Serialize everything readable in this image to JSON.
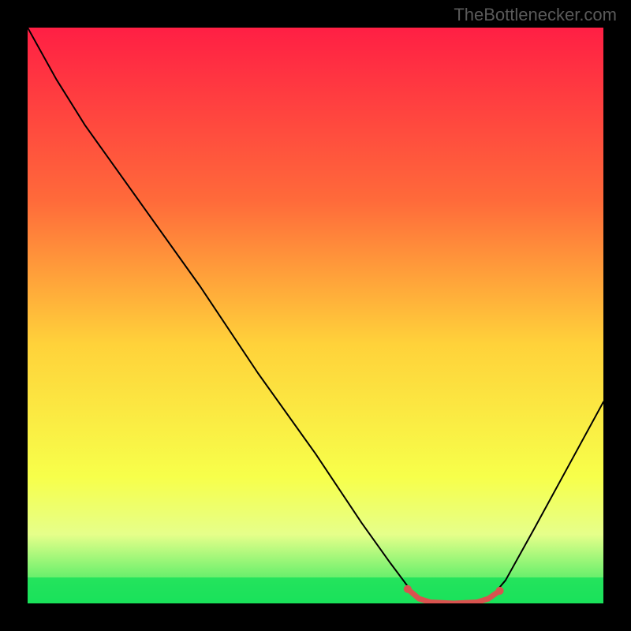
{
  "watermark": "TheBottlenecker.com",
  "chart_data": {
    "type": "line",
    "title": "",
    "xlabel": "",
    "ylabel": "",
    "xlim": [
      0,
      100
    ],
    "ylim": [
      0,
      100
    ],
    "background_gradient": {
      "stops": [
        {
          "offset": 0,
          "color": "#ff1f44"
        },
        {
          "offset": 30,
          "color": "#ff6a3a"
        },
        {
          "offset": 55,
          "color": "#ffd23a"
        },
        {
          "offset": 78,
          "color": "#f7ff4a"
        },
        {
          "offset": 88,
          "color": "#e6ff8a"
        },
        {
          "offset": 100,
          "color": "#1de65a"
        }
      ]
    },
    "green_band": {
      "from_y": 95.5,
      "to_y": 100
    },
    "series": [
      {
        "name": "curve",
        "color": "#000000",
        "width": 2,
        "points": [
          {
            "x": 0,
            "y": 0
          },
          {
            "x": 5,
            "y": 9
          },
          {
            "x": 10,
            "y": 17
          },
          {
            "x": 20,
            "y": 31
          },
          {
            "x": 30,
            "y": 45
          },
          {
            "x": 40,
            "y": 60
          },
          {
            "x": 50,
            "y": 74
          },
          {
            "x": 58,
            "y": 86
          },
          {
            "x": 63,
            "y": 93
          },
          {
            "x": 66,
            "y": 97
          },
          {
            "x": 68,
            "y": 99.5
          },
          {
            "x": 72,
            "y": 100
          },
          {
            "x": 78,
            "y": 100
          },
          {
            "x": 80,
            "y": 99.5
          },
          {
            "x": 83,
            "y": 96
          },
          {
            "x": 88,
            "y": 87
          },
          {
            "x": 94,
            "y": 76
          },
          {
            "x": 100,
            "y": 65
          }
        ]
      },
      {
        "name": "highlight",
        "color": "#d9534f",
        "width": 7,
        "points": [
          {
            "x": 66,
            "y": 97.5
          },
          {
            "x": 68,
            "y": 99.2
          },
          {
            "x": 70,
            "y": 99.8
          },
          {
            "x": 74,
            "y": 100
          },
          {
            "x": 78,
            "y": 99.8
          },
          {
            "x": 80,
            "y": 99.2
          },
          {
            "x": 82,
            "y": 97.8
          }
        ]
      }
    ]
  }
}
